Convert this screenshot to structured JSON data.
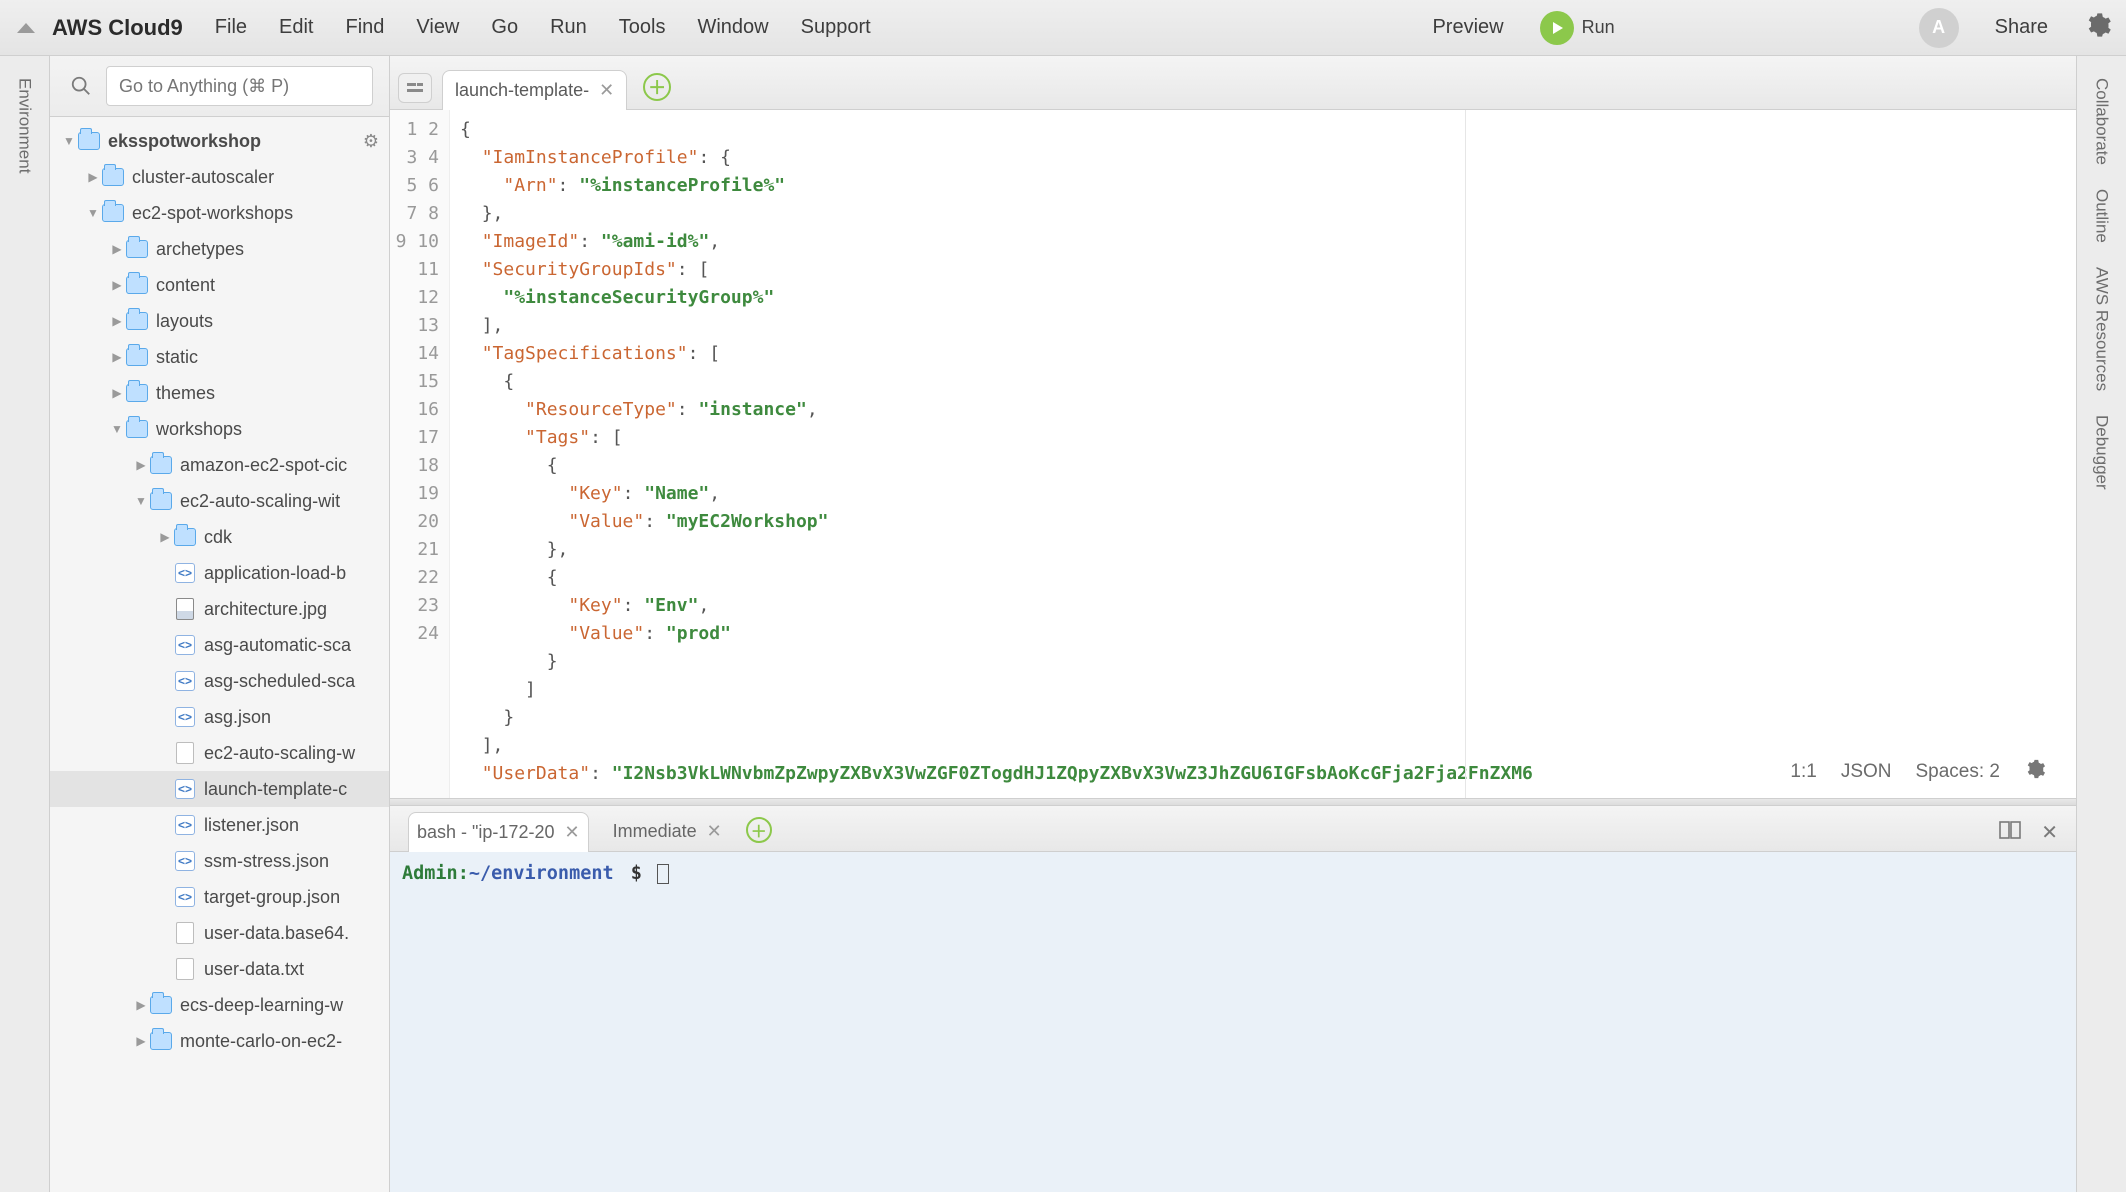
{
  "menubar": {
    "brand": "AWS Cloud9",
    "items": [
      "File",
      "Edit",
      "Find",
      "View",
      "Go",
      "Run",
      "Tools",
      "Window",
      "Support"
    ],
    "preview": "Preview",
    "run": "Run",
    "share": "Share",
    "avatar": "A"
  },
  "sidebar_rail": {
    "label": "Environment"
  },
  "right_rail": {
    "labels": [
      "Collaborate",
      "Outline",
      "AWS Resources",
      "Debugger"
    ]
  },
  "sidebar": {
    "search_placeholder": "Go to Anything (⌘ P)",
    "tree": [
      {
        "depth": 0,
        "type": "folder",
        "twisty": "down",
        "label": "eksspotworkshop",
        "root": true
      },
      {
        "depth": 1,
        "type": "folder",
        "twisty": "right",
        "label": "cluster-autoscaler"
      },
      {
        "depth": 1,
        "type": "folder",
        "twisty": "down",
        "label": "ec2-spot-workshops"
      },
      {
        "depth": 2,
        "type": "folder",
        "twisty": "right",
        "label": "archetypes"
      },
      {
        "depth": 2,
        "type": "folder",
        "twisty": "right",
        "label": "content"
      },
      {
        "depth": 2,
        "type": "folder",
        "twisty": "right",
        "label": "layouts"
      },
      {
        "depth": 2,
        "type": "folder",
        "twisty": "right",
        "label": "static"
      },
      {
        "depth": 2,
        "type": "folder",
        "twisty": "right",
        "label": "themes"
      },
      {
        "depth": 2,
        "type": "folder",
        "twisty": "down",
        "label": "workshops"
      },
      {
        "depth": 3,
        "type": "folder",
        "twisty": "right",
        "label": "amazon-ec2-spot-cic"
      },
      {
        "depth": 3,
        "type": "folder",
        "twisty": "down",
        "label": "ec2-auto-scaling-wit"
      },
      {
        "depth": 4,
        "type": "folder",
        "twisty": "right",
        "label": "cdk"
      },
      {
        "depth": 4,
        "type": "code",
        "label": "application-load-b"
      },
      {
        "depth": 4,
        "type": "image",
        "label": "architecture.jpg"
      },
      {
        "depth": 4,
        "type": "code",
        "label": "asg-automatic-sca"
      },
      {
        "depth": 4,
        "type": "code",
        "label": "asg-scheduled-sca"
      },
      {
        "depth": 4,
        "type": "code",
        "label": "asg.json"
      },
      {
        "depth": 4,
        "type": "file",
        "label": "ec2-auto-scaling-w"
      },
      {
        "depth": 4,
        "type": "code",
        "label": "launch-template-c",
        "selected": true
      },
      {
        "depth": 4,
        "type": "code",
        "label": "listener.json"
      },
      {
        "depth": 4,
        "type": "code",
        "label": "ssm-stress.json"
      },
      {
        "depth": 4,
        "type": "code",
        "label": "target-group.json"
      },
      {
        "depth": 4,
        "type": "file",
        "label": "user-data.base64."
      },
      {
        "depth": 4,
        "type": "file",
        "label": "user-data.txt"
      },
      {
        "depth": 3,
        "type": "folder",
        "twisty": "right",
        "label": "ecs-deep-learning-w"
      },
      {
        "depth": 3,
        "type": "folder",
        "twisty": "right",
        "label": "monte-carlo-on-ec2-"
      }
    ]
  },
  "editor": {
    "tab_label": "launch-template-",
    "line_numbers": [
      "1",
      "2",
      "3",
      "4",
      "5",
      "6",
      "7",
      "8",
      "9",
      "10",
      "11",
      "12",
      "13",
      "14",
      "15",
      "16",
      "17",
      "18",
      "19",
      "20",
      "21",
      "22",
      "23",
      "24"
    ],
    "lines": [
      [
        [
          "p",
          "{"
        ]
      ],
      [
        [
          "t",
          "  "
        ],
        [
          "k",
          "\"IamInstanceProfile\""
        ],
        [
          "p",
          ": {"
        ]
      ],
      [
        [
          "t",
          "    "
        ],
        [
          "k",
          "\"Arn\""
        ],
        [
          "p",
          ": "
        ],
        [
          "s",
          "\"%instanceProfile%\""
        ]
      ],
      [
        [
          "t",
          "  "
        ],
        [
          "p",
          "},"
        ]
      ],
      [
        [
          "t",
          "  "
        ],
        [
          "k",
          "\"ImageId\""
        ],
        [
          "p",
          ": "
        ],
        [
          "s",
          "\"%ami-id%\""
        ],
        [
          "p",
          ","
        ]
      ],
      [
        [
          "t",
          "  "
        ],
        [
          "k",
          "\"SecurityGroupIds\""
        ],
        [
          "p",
          ": ["
        ]
      ],
      [
        [
          "t",
          "    "
        ],
        [
          "s",
          "\"%instanceSecurityGroup%\""
        ]
      ],
      [
        [
          "t",
          "  "
        ],
        [
          "p",
          "],"
        ]
      ],
      [
        [
          "t",
          "  "
        ],
        [
          "k",
          "\"TagSpecifications\""
        ],
        [
          "p",
          ": ["
        ]
      ],
      [
        [
          "t",
          "    "
        ],
        [
          "p",
          "{"
        ]
      ],
      [
        [
          "t",
          "      "
        ],
        [
          "k",
          "\"ResourceType\""
        ],
        [
          "p",
          ": "
        ],
        [
          "s",
          "\"instance\""
        ],
        [
          "p",
          ","
        ]
      ],
      [
        [
          "t",
          "      "
        ],
        [
          "k",
          "\"Tags\""
        ],
        [
          "p",
          ": ["
        ]
      ],
      [
        [
          "t",
          "        "
        ],
        [
          "p",
          "{"
        ]
      ],
      [
        [
          "t",
          "          "
        ],
        [
          "k",
          "\"Key\""
        ],
        [
          "p",
          ": "
        ],
        [
          "s",
          "\"Name\""
        ],
        [
          "p",
          ","
        ]
      ],
      [
        [
          "t",
          "          "
        ],
        [
          "k",
          "\"Value\""
        ],
        [
          "p",
          ": "
        ],
        [
          "s",
          "\"myEC2Workshop\""
        ]
      ],
      [
        [
          "t",
          "        "
        ],
        [
          "p",
          "},"
        ]
      ],
      [
        [
          "t",
          "        "
        ],
        [
          "p",
          "{"
        ]
      ],
      [
        [
          "t",
          "          "
        ],
        [
          "k",
          "\"Key\""
        ],
        [
          "p",
          ": "
        ],
        [
          "s",
          "\"Env\""
        ],
        [
          "p",
          ","
        ]
      ],
      [
        [
          "t",
          "          "
        ],
        [
          "k",
          "\"Value\""
        ],
        [
          "p",
          ": "
        ],
        [
          "s",
          "\"prod\""
        ]
      ],
      [
        [
          "t",
          "        "
        ],
        [
          "p",
          "}"
        ]
      ],
      [
        [
          "t",
          "      "
        ],
        [
          "p",
          "]"
        ]
      ],
      [
        [
          "t",
          "    "
        ],
        [
          "p",
          "}"
        ]
      ],
      [
        [
          "t",
          "  "
        ],
        [
          "p",
          "],"
        ]
      ],
      [
        [
          "t",
          "  "
        ],
        [
          "k",
          "\"UserData\""
        ],
        [
          "p",
          ": "
        ],
        [
          "s",
          "\"I2Nsb3VkLWNvbmZpZwpyZXBvX3VwZGF0ZTogdHJ1ZQpyZXBvX3VwZ3JhZGU6IGFsbAoKcGFja2Fja2FnZXM6"
        ]
      ]
    ],
    "status": {
      "pos": "1:1",
      "lang": "JSON",
      "spaces": "Spaces: 2"
    }
  },
  "terminal": {
    "tabs": [
      {
        "label": "bash - \"ip-172-20",
        "active": true
      },
      {
        "label": "Immediate",
        "active": false
      }
    ],
    "user": "Admin:",
    "path": "~/environment",
    "prompt": "$"
  }
}
